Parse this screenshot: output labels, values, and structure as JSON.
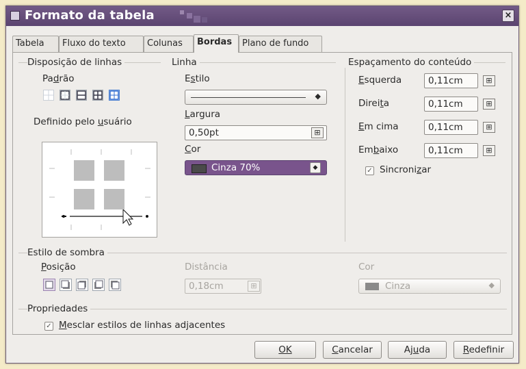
{
  "window": {
    "title": "Formato da tabela",
    "close_glyph": "×"
  },
  "tabs": [
    {
      "label": "Tabela",
      "active": false
    },
    {
      "label": "Fluxo do texto",
      "active": false
    },
    {
      "label": "Colunas",
      "active": false
    },
    {
      "label": "Bordas",
      "active": true
    },
    {
      "label": "Plano de fundo",
      "active": false
    }
  ],
  "line_arrangement": {
    "title": "Disposição de linhas",
    "default_label": "Padrão",
    "user_defined_label": "Definido pelo usuário"
  },
  "line": {
    "title": "Linha",
    "style_label": "Estilo",
    "width_label": "Largura",
    "width_value": "0,50pt",
    "color_label": "Cor",
    "color_value": "Cinza 70%",
    "color_swatch": "#4a4a4a"
  },
  "spacing": {
    "title": "Espaçamento do conteúdo",
    "left_label": "Esquerda",
    "left_value": "0,11cm",
    "right_label": "Direita",
    "right_value": "0,11cm",
    "top_label": "Em cima",
    "top_value": "0,11cm",
    "bottom_label": "Embaixo",
    "bottom_value": "0,11cm",
    "sync_label": "Sincronizar",
    "sync_checked": true
  },
  "shadow": {
    "title": "Estilo de sombra",
    "position_label": "Posição",
    "distance_label": "Distância",
    "distance_value": "0,18cm",
    "color_label": "Cor",
    "color_value": "Cinza",
    "color_swatch": "#8a8a8a"
  },
  "properties": {
    "title": "Propriedades",
    "merge_label": "Mesclar estilos de linhas adjacentes",
    "merge_checked": true
  },
  "buttons": {
    "ok": "OK",
    "cancel": "Cancelar",
    "help": "Ajuda",
    "reset": "Redefinir"
  },
  "colors": {
    "titlebar": "#5b4470",
    "accent": "#6a4f7f",
    "selection": "#79548c"
  }
}
